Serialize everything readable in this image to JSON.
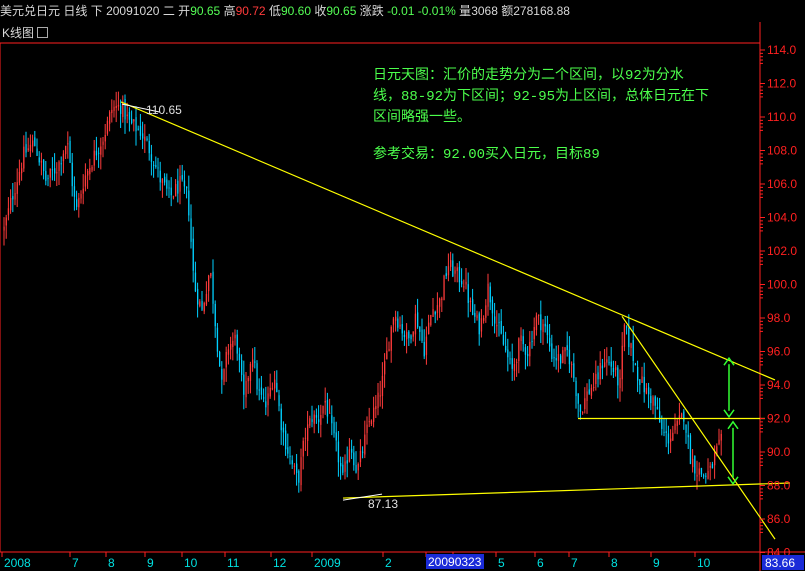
{
  "header": {
    "symbol": "美元兑日元",
    "period": "日线",
    "mode": "下",
    "date": "20091020",
    "weekday": "二",
    "open_label": "开",
    "open": "90.65",
    "high_label": "高",
    "high": "90.72",
    "low_label": "低",
    "low": "90.60",
    "close_label": "收",
    "close": "90.65",
    "change_label": "涨跌",
    "change": "-0.01",
    "change_pct": "-0.01%",
    "volume_label": "量",
    "volume": "3068",
    "amount_label": "额",
    "amount": "278168.88"
  },
  "subheader": {
    "label": "K线图"
  },
  "annotation": {
    "line1": "日元天图：汇价的走势分为二个区间，以92为分水",
    "line2": "线，88-92为下区间；92-95为上区间，总体日元在下",
    "line3": "区间略强一些。",
    "line4": "参考交易：92.00买入日元，目标89"
  },
  "colors": {
    "up": "#ff3b3b",
    "down": "#00d0ff",
    "trendline": "#ffff00",
    "arrow": "#33ff33",
    "annotation": "#4cff4c",
    "axis": "#ff2020"
  },
  "chart_data": {
    "type": "candlestick",
    "ylim": [
      83.66,
      114.5
    ],
    "yticks": [
      "114.0",
      "112.0",
      "110.0",
      "108.0",
      "106.0",
      "104.0",
      "102.0",
      "100.0",
      "98.0",
      "96.0",
      "94.0",
      "92.0",
      "90.0",
      "88.0",
      "86.0",
      "84.0"
    ],
    "current_price_label": "83.66",
    "xticks": [
      "2008",
      "7",
      "8",
      "9",
      "10",
      "11",
      "12",
      "2009",
      "2",
      "3",
      "4",
      "5",
      "6",
      "7",
      "8",
      "9",
      "10"
    ],
    "cursor_label": "20090323",
    "high_marker": {
      "value": 110.65,
      "label": "110.65"
    },
    "low_marker": {
      "value": 87.13,
      "label": "87.13"
    },
    "trendlines": [
      {
        "name": "upper-resistance",
        "from": [
          121,
          110.9
        ],
        "to": [
          775,
          94.3
        ]
      },
      {
        "name": "lower-support",
        "from": [
          343,
          87.25
        ],
        "to": [
          790,
          88.15
        ]
      },
      {
        "name": "steep-down",
        "from": [
          622,
          98.1
        ],
        "to": [
          775,
          84.8
        ]
      },
      {
        "name": "level-92",
        "from": [
          578,
          92.0
        ],
        "to": [
          765,
          92.0
        ]
      }
    ],
    "arrows": [
      {
        "x": 729,
        "from": 95.6,
        "to": 92.1
      },
      {
        "x": 733,
        "from": 91.8,
        "to": 88.1
      }
    ],
    "anchors": [
      [
        4,
        103.3
      ],
      [
        12,
        105.2
      ],
      [
        24,
        107.8
      ],
      [
        34,
        108.5
      ],
      [
        46,
        106.2
      ],
      [
        58,
        107.1
      ],
      [
        67,
        108.6
      ],
      [
        76,
        104.3
      ],
      [
        84,
        106.3
      ],
      [
        94,
        107.7
      ],
      [
        104,
        108.9
      ],
      [
        112,
        110.5
      ],
      [
        121,
        110.65
      ],
      [
        130,
        109.6
      ],
      [
        140,
        109.2
      ],
      [
        150,
        108.0
      ],
      [
        160,
        106.3
      ],
      [
        170,
        105.2
      ],
      [
        180,
        106.0
      ],
      [
        188,
        105.2
      ],
      [
        194,
        100.0
      ],
      [
        202,
        98.4
      ],
      [
        210,
        101.0
      ],
      [
        216,
        97.3
      ],
      [
        222,
        93.8
      ],
      [
        228,
        96.3
      ],
      [
        236,
        96.8
      ],
      [
        244,
        93.0
      ],
      [
        252,
        96.1
      ],
      [
        258,
        93.6
      ],
      [
        266,
        92.7
      ],
      [
        274,
        94.7
      ],
      [
        282,
        91.4
      ],
      [
        290,
        89.6
      ],
      [
        298,
        88.2
      ],
      [
        305,
        91.0
      ],
      [
        312,
        92.1
      ],
      [
        318,
        91.9
      ],
      [
        325,
        93.1
      ],
      [
        332,
        91.2
      ],
      [
        338,
        89.8
      ],
      [
        343,
        88.3
      ],
      [
        350,
        90.6
      ],
      [
        357,
        88.8
      ],
      [
        364,
        90.5
      ],
      [
        370,
        92.0
      ],
      [
        376,
        92.6
      ],
      [
        382,
        94.1
      ],
      [
        388,
        96.3
      ],
      [
        394,
        98.4
      ],
      [
        400,
        97.6
      ],
      [
        408,
        96.6
      ],
      [
        416,
        98.2
      ],
      [
        424,
        96.1
      ],
      [
        432,
        98.5
      ],
      [
        440,
        99.0
      ],
      [
        448,
        101.2
      ],
      [
        456,
        100.6
      ],
      [
        464,
        100.2
      ],
      [
        472,
        98.3
      ],
      [
        480,
        97.4
      ],
      [
        488,
        99.8
      ],
      [
        496,
        97.8
      ],
      [
        504,
        96.3
      ],
      [
        512,
        94.8
      ],
      [
        520,
        96.6
      ],
      [
        528,
        96.0
      ],
      [
        536,
        98.0
      ],
      [
        544,
        97.6
      ],
      [
        552,
        95.8
      ],
      [
        560,
        95.5
      ],
      [
        568,
        96.0
      ],
      [
        574,
        94.4
      ],
      [
        580,
        92.4
      ],
      [
        588,
        93.6
      ],
      [
        596,
        94.2
      ],
      [
        604,
        95.6
      ],
      [
        612,
        95.1
      ],
      [
        620,
        94.0
      ],
      [
        624,
        97.5
      ],
      [
        630,
        96.4
      ],
      [
        638,
        94.6
      ],
      [
        646,
        93.6
      ],
      [
        654,
        93.0
      ],
      [
        662,
        91.2
      ],
      [
        668,
        90.8
      ],
      [
        676,
        91.4
      ],
      [
        684,
        92.3
      ],
      [
        690,
        89.8
      ],
      [
        696,
        89.0
      ],
      [
        704,
        88.6
      ],
      [
        710,
        88.8
      ],
      [
        716,
        89.9
      ],
      [
        722,
        90.7
      ]
    ]
  }
}
